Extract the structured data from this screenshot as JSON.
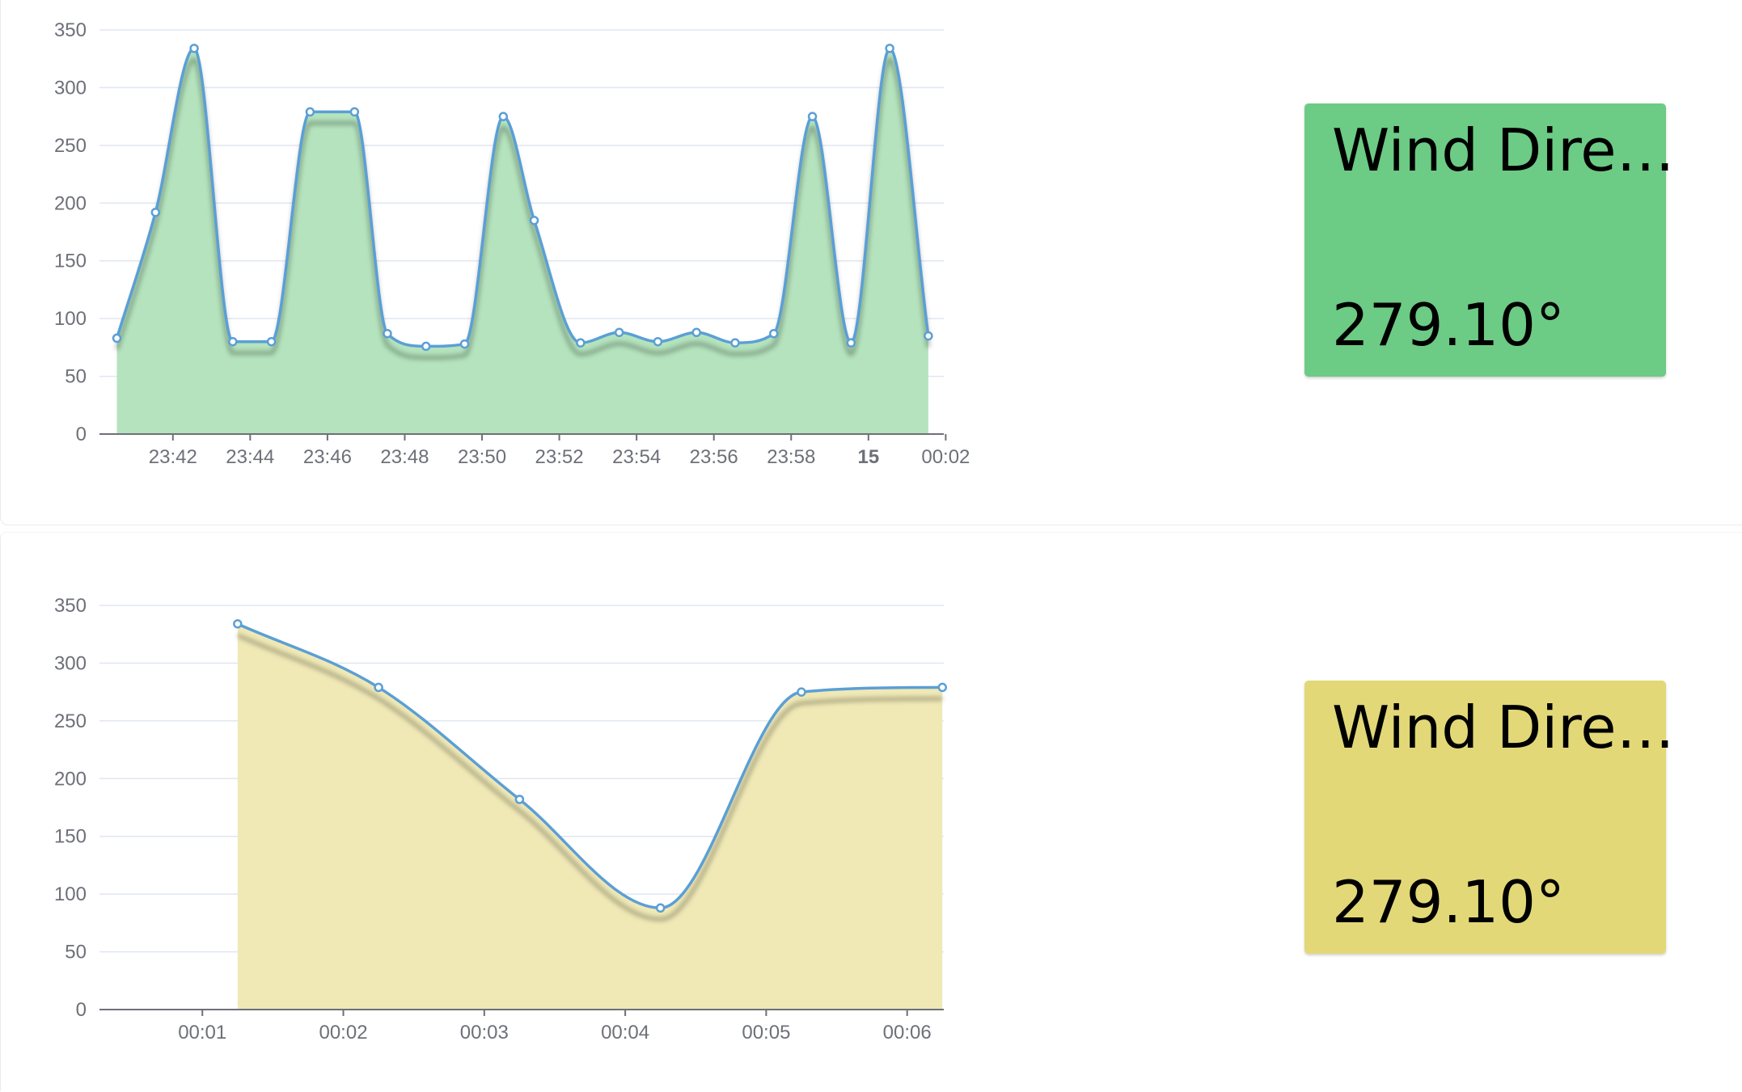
{
  "cards": [
    {
      "title": "Wind Dire…",
      "value": "279.10°",
      "color": "#6ccb84"
    },
    {
      "title": "Wind Dire…",
      "value": "279.10°",
      "color": "#e2d877"
    }
  ],
  "chart_data": [
    {
      "type": "area",
      "smooth": true,
      "fill_color": "#b4e3bd",
      "line_color": "#5b9fd5",
      "grid": true,
      "ylim": [
        0,
        350
      ],
      "yticks": [
        0,
        50,
        100,
        150,
        200,
        250,
        300,
        350
      ],
      "xticks": [
        {
          "label": "23:42",
          "t": 23.7
        },
        {
          "label": "23:44",
          "t": 25.7
        },
        {
          "label": "23:46",
          "t": 27.7
        },
        {
          "label": "23:48",
          "t": 29.7
        },
        {
          "label": "23:50",
          "t": 31.7
        },
        {
          "label": "23:52",
          "t": 33.7
        },
        {
          "label": "23:54",
          "t": 35.7
        },
        {
          "label": "23:56",
          "t": 37.7
        },
        {
          "label": "23:58",
          "t": 39.7
        },
        {
          "label": "15",
          "t": 41.7,
          "bold": true
        },
        {
          "label": "00:02",
          "t": 43.7
        }
      ],
      "x_range": [
        21.8,
        43.65
      ],
      "points": [
        {
          "t": 22.25,
          "y": 83
        },
        {
          "t": 23.25,
          "y": 192
        },
        {
          "t": 24.25,
          "y": 334
        },
        {
          "t": 25.25,
          "y": 80
        },
        {
          "t": 26.25,
          "y": 80
        },
        {
          "t": 27.25,
          "y": 279
        },
        {
          "t": 28.4,
          "y": 279
        },
        {
          "t": 29.25,
          "y": 87
        },
        {
          "t": 30.25,
          "y": 76
        },
        {
          "t": 31.25,
          "y": 78
        },
        {
          "t": 32.25,
          "y": 275
        },
        {
          "t": 33.05,
          "y": 185
        },
        {
          "t": 34.25,
          "y": 79
        },
        {
          "t": 35.25,
          "y": 88
        },
        {
          "t": 36.25,
          "y": 80
        },
        {
          "t": 37.25,
          "y": 88
        },
        {
          "t": 38.25,
          "y": 79
        },
        {
          "t": 39.25,
          "y": 87
        },
        {
          "t": 40.25,
          "y": 275
        },
        {
          "t": 41.25,
          "y": 79
        },
        {
          "t": 42.25,
          "y": 334
        },
        {
          "t": 43.25,
          "y": 85
        }
      ]
    },
    {
      "type": "area",
      "smooth": true,
      "fill_color": "#f0e9b6",
      "line_color": "#5b9fd5",
      "grid": true,
      "ylim": [
        0,
        350
      ],
      "yticks": [
        0,
        50,
        100,
        150,
        200,
        250,
        300,
        350
      ],
      "xticks": [
        {
          "label": "00:01",
          "t": 1.0
        },
        {
          "label": "00:02",
          "t": 2.0
        },
        {
          "label": "00:03",
          "t": 3.0
        },
        {
          "label": "00:04",
          "t": 4.0
        },
        {
          "label": "00:05",
          "t": 5.0
        },
        {
          "label": "00:06",
          "t": 6.0
        }
      ],
      "x_range": [
        0.27,
        6.26
      ],
      "points": [
        {
          "t": 1.25,
          "y": 334
        },
        {
          "t": 2.25,
          "y": 279
        },
        {
          "t": 3.25,
          "y": 182
        },
        {
          "t": 4.25,
          "y": 88
        },
        {
          "t": 5.25,
          "y": 275
        },
        {
          "t": 6.25,
          "y": 279
        }
      ]
    }
  ]
}
